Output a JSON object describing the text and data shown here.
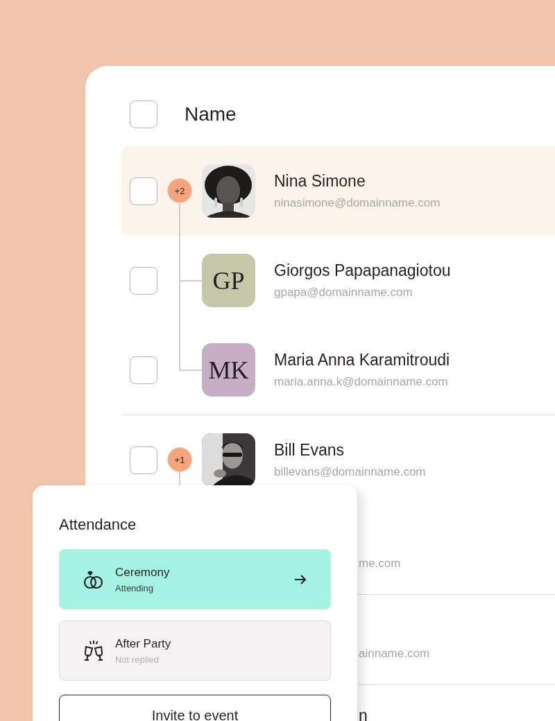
{
  "table": {
    "header": {
      "checked": false,
      "label": "Name"
    },
    "groups": [
      {
        "kind": "contact",
        "name": "Nina Simone",
        "email": "ninasimone@domainname.com",
        "avatar": {
          "kind": "picture"
        },
        "badge": "+2",
        "highlighted": true,
        "checked": false,
        "children": [
          {
            "kind": "contact",
            "name": "Giorgos Papapanagiotou",
            "email": "gpapa@domainname.com",
            "avatar": {
              "kind": "initials",
              "initials": "GP",
              "color": "#c4c7a8"
            },
            "highlighted": false,
            "checked": false
          },
          {
            "kind": "contact",
            "name": "Maria Anna Karamitroudi",
            "email": "maria.anna.k@domainname.com",
            "avatar": {
              "kind": "initials",
              "initials": "MK",
              "color": "#c7adc6"
            },
            "highlighted": false,
            "checked": false
          }
        ]
      },
      {
        "kind": "contact",
        "name": "Bill Evans",
        "email": "billevans@domainname.com",
        "avatar": {
          "kind": "picture"
        },
        "badge": "+1",
        "highlighted": false,
        "checked": false,
        "children": [
          {
            "kind": "partial",
            "email": "me.com"
          }
        ]
      },
      {
        "kind": "partial",
        "email": "ainname.com"
      },
      {
        "kind": "partial",
        "name": "n"
      }
    ]
  },
  "attendance": {
    "title": "Attendance",
    "events": [
      {
        "name": "Ceremony",
        "status": "Attending",
        "selected": true
      },
      {
        "name": "After Party",
        "status": "Not replied",
        "selected": false
      }
    ],
    "invite_button": "Invite to event"
  }
}
